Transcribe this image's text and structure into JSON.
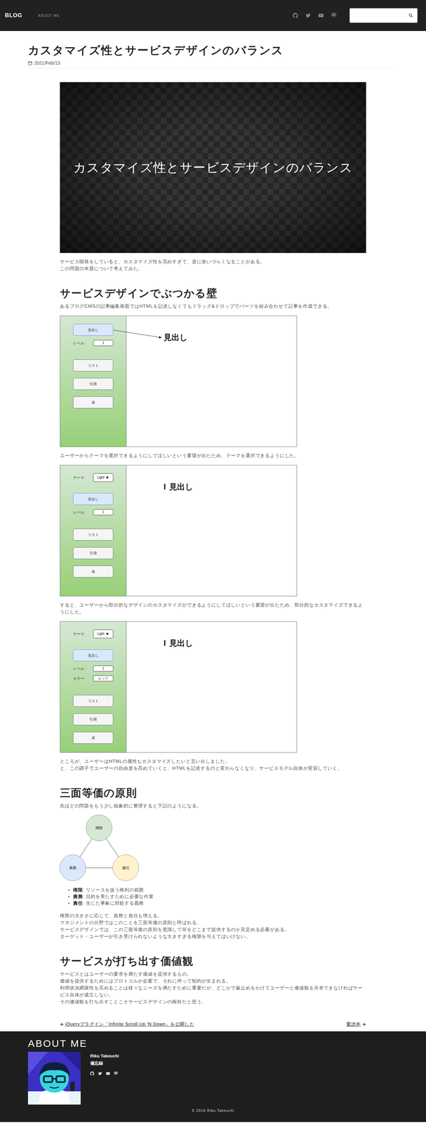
{
  "header": {
    "brand": "BLOG",
    "nav": [
      {
        "label": "ABOUT ME"
      }
    ]
  },
  "article": {
    "title": "カスタマイズ性とサービスデザインのバランス",
    "date": "2021/Feb/13",
    "hero": {
      "caption": "カスタマイズ性とサービスデザインのバランス"
    },
    "blocks": [
      {
        "kind": "paragraph",
        "lines": [
          "サービス開発をしていると、カスタマイズ性を高めすぎて、逆に使いづらくなることがある。",
          "この問題の本質について考えてみた。"
        ]
      },
      {
        "kind": "heading",
        "text": "サービスデザインでぶつかる壁"
      },
      {
        "kind": "paragraph",
        "lines": [
          "あるブログCMSの記事編集画面ではHTMLを記述しなくてもドラッグ&ドロップでパーツを組み合わせて記事を作成できる。"
        ]
      },
      {
        "kind": "editor",
        "arrow": true,
        "controls": [
          {
            "kind": "button",
            "label": "見出し",
            "selected": true
          },
          {
            "kind": "field",
            "label": "レベル:",
            "value": "1"
          },
          {
            "kind": "button",
            "label": "リスト",
            "selected": false
          },
          {
            "kind": "button",
            "label": "引用",
            "selected": false
          },
          {
            "kind": "button",
            "label": "表",
            "selected": false
          }
        ],
        "preview": {
          "text": "見出し"
        }
      },
      {
        "kind": "paragraph",
        "lines": [
          "ユーザーからテーマを選択できるようにしてほしいという要望が出たため、テーマを選択できるようにした。"
        ]
      },
      {
        "kind": "editor",
        "arrow": false,
        "controls": [
          {
            "kind": "select",
            "label": "テーマ:",
            "value": "Light",
            "glyph": "▼"
          },
          {
            "kind": "button",
            "label": "見出し",
            "selected": true
          },
          {
            "kind": "field",
            "label": "レベル:",
            "value": "1"
          },
          {
            "kind": "button",
            "label": "リスト",
            "selected": false
          },
          {
            "kind": "button",
            "label": "引用",
            "selected": false
          },
          {
            "kind": "button",
            "label": "表",
            "selected": false
          }
        ],
        "preview": {
          "caret": "I",
          "text": "見出し"
        }
      },
      {
        "kind": "paragraph",
        "lines": [
          "すると、ユーザーから部分的なデザインのカスタマイズができるようにしてほしいという要望が出たため、部分的なカスタマイズできるようにした。"
        ]
      },
      {
        "kind": "editor",
        "arrow": false,
        "controls": [
          {
            "kind": "select",
            "label": "テーマ:",
            "value": "Light",
            "glyph": "▼"
          },
          {
            "kind": "button",
            "label": "見出し",
            "selected": true
          },
          {
            "kind": "field",
            "label": "レベル:",
            "value": "1"
          },
          {
            "kind": "field",
            "label": "カラー:",
            "value": "レッド"
          },
          {
            "kind": "button",
            "label": "リスト",
            "selected": false
          },
          {
            "kind": "button",
            "label": "引用",
            "selected": false
          },
          {
            "kind": "button",
            "label": "表",
            "selected": false
          }
        ],
        "preview": {
          "caret": "I",
          "text": "見出し"
        }
      },
      {
        "kind": "paragraph",
        "lines": [
          "ところが、ユーザーはHTMLの属性もカスタマイズしたいと言い出しました。",
          "と、この調子でユーザーの自由度を高めていくと、HTMLを記述するのと変わらなくなり、サービスモデル自体が変容していく。"
        ]
      },
      {
        "kind": "heading",
        "text": "三面等価の原則"
      },
      {
        "kind": "paragraph",
        "lines": [
          "先ほどの問題をもう少し抽象的に整理すると下記のようになる。"
        ]
      },
      {
        "kind": "triad",
        "nodes": [
          {
            "label": "権限",
            "color": "#d5e8d4"
          },
          {
            "label": "責務",
            "color": "#dae8fc"
          },
          {
            "label": "責任",
            "color": "#fff2cc"
          }
        ]
      },
      {
        "kind": "list",
        "items": [
          {
            "term": "権限",
            "text": ": リソースを扱う権利の範囲"
          },
          {
            "term": "責務",
            "text": ": 目的を果たすために必要な作業"
          },
          {
            "term": "責任",
            "text": ": 生じた事象に対処する義務"
          }
        ]
      },
      {
        "kind": "paragraph",
        "lines": [
          "権限の大きさに応じて、責務と責任も増える。",
          "マネジメントの分野ではこのことを三面等価の原則と呼ばれる。",
          "サービスデザインでは、この三面等価の原則を意識して何をどこまで提供するのか見定める必要がある。",
          "ターゲット・ユーザーが引き受けられないような大きすぎる権限を与えてはいけない。"
        ]
      },
      {
        "kind": "heading",
        "text": "サービスが打ち出す価値観"
      },
      {
        "kind": "paragraph",
        "lines": [
          "サービスとはユーザーの要求を満たす価値を提供するもの。",
          "価値を提供するためにはプロトコルが必要で、それに伴って制約が生まれる。",
          "利用状況網羅性を高めることは様々なニーズを満たすために重要だが、どこかで歯止めをかけてユーザーと価値観を共有できなければサービス自体が成立しない。",
          "その価値観を打ち出すことこそサービスデザインの根幹だと思う。"
        ]
      }
    ]
  },
  "pager": {
    "prev": "jQueryプラグイン「Infinite Scroll Up 'N Down」を公開した",
    "next": "愛読本"
  },
  "footer": {
    "heading": "ABOUT ME",
    "name": "Riku Takeuchi",
    "tagline": "備忘録",
    "copyright": "© 2016 Riku Takeuchi"
  }
}
